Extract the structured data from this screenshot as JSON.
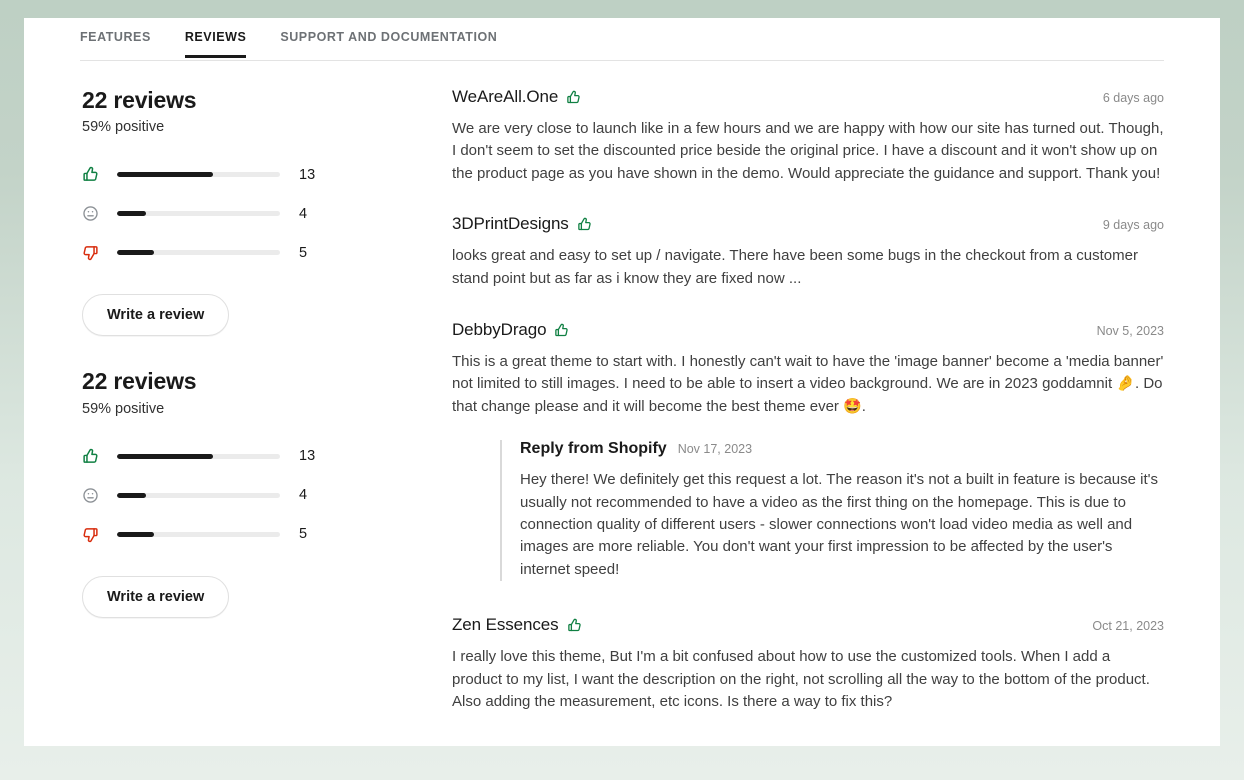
{
  "tabs": [
    {
      "label": "FEATURES",
      "active": false
    },
    {
      "label": "REVIEWS",
      "active": true
    },
    {
      "label": "SUPPORT AND DOCUMENTATION",
      "active": false
    }
  ],
  "summary_blocks": [
    {
      "title": "22 reviews",
      "subtitle": "59% positive",
      "bars": [
        {
          "icon": "thumbs-up-icon",
          "color": "#108043",
          "count": "13",
          "percent": 59
        },
        {
          "icon": "neutral-face-icon",
          "color": "#8c9196",
          "count": "4",
          "percent": 18
        },
        {
          "icon": "thumbs-down-icon",
          "color": "#d82c0d",
          "count": "5",
          "percent": 23
        }
      ],
      "write_review_label": "Write a review"
    },
    {
      "title": "22 reviews",
      "subtitle": "59% positive",
      "bars": [
        {
          "icon": "thumbs-up-icon",
          "color": "#108043",
          "count": "13",
          "percent": 59
        },
        {
          "icon": "neutral-face-icon",
          "color": "#8c9196",
          "count": "4",
          "percent": 18
        },
        {
          "icon": "thumbs-down-icon",
          "color": "#d82c0d",
          "count": "5",
          "percent": 23
        }
      ],
      "write_review_label": "Write a review"
    }
  ],
  "reviews": [
    {
      "author": "WeAreAll.One",
      "rating_icon": "thumbs-up-icon",
      "date": "6 days ago",
      "body": "We are very close to launch like in a few hours and we are happy with how our site has turned out. Though, I don't seem to set the discounted price beside the original price. I have a discount and it won't show up on the product page as you have shown in the demo. Would appreciate the guidance and support. Thank you!",
      "reply": null
    },
    {
      "author": "3DPrintDesigns",
      "rating_icon": "thumbs-up-icon",
      "date": "9 days ago",
      "body": "looks great and easy to set up / navigate. There have been some bugs in the checkout from a customer stand point but as far as i know they are fixed now ...",
      "reply": null
    },
    {
      "author": "DebbyDrago",
      "rating_icon": "thumbs-up-icon",
      "date": "Nov 5, 2023",
      "body_part1": "This is a great theme to start with. I honestly can't wait to have the 'image banner' become a 'media banner' not limited to still images. I need to be able to insert a video background. We are in 2023 goddamnit ",
      "emoji1": "🤌",
      "body_part2": ". Do that change please and it will become the best theme ever ",
      "emoji2": "🤩",
      "body_part3": ".",
      "reply": {
        "title": "Reply from Shopify",
        "date": "Nov 17, 2023",
        "body": "Hey there! We definitely get this request a lot. The reason it's not a built in feature is because it's usually not recommended to have a video as the first thing on the homepage. This is due to connection quality of different users - slower connections won't load video media as well and images are more reliable. You don't want your first impression to be affected by the user's internet speed!"
      }
    },
    {
      "author": "Zen Essences",
      "rating_icon": "thumbs-up-icon",
      "date": "Oct 21, 2023",
      "body": "I really love this theme, But I'm a bit confused about how to use the customized tools. When I add a product to my list, I want the description on the right, not scrolling all the way to the bottom of the product. Also adding the measurement, etc icons. Is there a way to fix this?",
      "reply": null
    }
  ],
  "colors": {
    "page_background_top": "#bed0c4",
    "page_background_bottom": "#e8efea",
    "card": "#ffffff",
    "positive": "#108043",
    "neutral": "#8c9196",
    "negative": "#d82c0d",
    "bar_fill": "#1a1a1a",
    "bar_track": "#ebebeb"
  }
}
